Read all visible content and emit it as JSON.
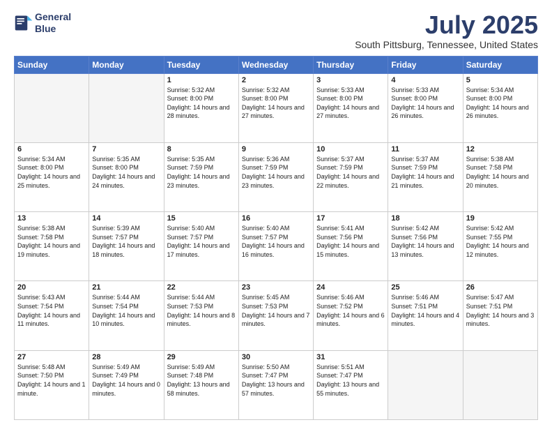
{
  "logo": {
    "line1": "General",
    "line2": "Blue"
  },
  "header": {
    "title": "July 2025",
    "subtitle": "South Pittsburg, Tennessee, United States"
  },
  "days_of_week": [
    "Sunday",
    "Monday",
    "Tuesday",
    "Wednesday",
    "Thursday",
    "Friday",
    "Saturday"
  ],
  "weeks": [
    [
      {
        "day": "",
        "content": ""
      },
      {
        "day": "",
        "content": ""
      },
      {
        "day": "1",
        "content": "Sunrise: 5:32 AM\nSunset: 8:00 PM\nDaylight: 14 hours and 28 minutes."
      },
      {
        "day": "2",
        "content": "Sunrise: 5:32 AM\nSunset: 8:00 PM\nDaylight: 14 hours and 27 minutes."
      },
      {
        "day": "3",
        "content": "Sunrise: 5:33 AM\nSunset: 8:00 PM\nDaylight: 14 hours and 27 minutes."
      },
      {
        "day": "4",
        "content": "Sunrise: 5:33 AM\nSunset: 8:00 PM\nDaylight: 14 hours and 26 minutes."
      },
      {
        "day": "5",
        "content": "Sunrise: 5:34 AM\nSunset: 8:00 PM\nDaylight: 14 hours and 26 minutes."
      }
    ],
    [
      {
        "day": "6",
        "content": "Sunrise: 5:34 AM\nSunset: 8:00 PM\nDaylight: 14 hours and 25 minutes."
      },
      {
        "day": "7",
        "content": "Sunrise: 5:35 AM\nSunset: 8:00 PM\nDaylight: 14 hours and 24 minutes."
      },
      {
        "day": "8",
        "content": "Sunrise: 5:35 AM\nSunset: 7:59 PM\nDaylight: 14 hours and 23 minutes."
      },
      {
        "day": "9",
        "content": "Sunrise: 5:36 AM\nSunset: 7:59 PM\nDaylight: 14 hours and 23 minutes."
      },
      {
        "day": "10",
        "content": "Sunrise: 5:37 AM\nSunset: 7:59 PM\nDaylight: 14 hours and 22 minutes."
      },
      {
        "day": "11",
        "content": "Sunrise: 5:37 AM\nSunset: 7:59 PM\nDaylight: 14 hours and 21 minutes."
      },
      {
        "day": "12",
        "content": "Sunrise: 5:38 AM\nSunset: 7:58 PM\nDaylight: 14 hours and 20 minutes."
      }
    ],
    [
      {
        "day": "13",
        "content": "Sunrise: 5:38 AM\nSunset: 7:58 PM\nDaylight: 14 hours and 19 minutes."
      },
      {
        "day": "14",
        "content": "Sunrise: 5:39 AM\nSunset: 7:57 PM\nDaylight: 14 hours and 18 minutes."
      },
      {
        "day": "15",
        "content": "Sunrise: 5:40 AM\nSunset: 7:57 PM\nDaylight: 14 hours and 17 minutes."
      },
      {
        "day": "16",
        "content": "Sunrise: 5:40 AM\nSunset: 7:57 PM\nDaylight: 14 hours and 16 minutes."
      },
      {
        "day": "17",
        "content": "Sunrise: 5:41 AM\nSunset: 7:56 PM\nDaylight: 14 hours and 15 minutes."
      },
      {
        "day": "18",
        "content": "Sunrise: 5:42 AM\nSunset: 7:56 PM\nDaylight: 14 hours and 13 minutes."
      },
      {
        "day": "19",
        "content": "Sunrise: 5:42 AM\nSunset: 7:55 PM\nDaylight: 14 hours and 12 minutes."
      }
    ],
    [
      {
        "day": "20",
        "content": "Sunrise: 5:43 AM\nSunset: 7:54 PM\nDaylight: 14 hours and 11 minutes."
      },
      {
        "day": "21",
        "content": "Sunrise: 5:44 AM\nSunset: 7:54 PM\nDaylight: 14 hours and 10 minutes."
      },
      {
        "day": "22",
        "content": "Sunrise: 5:44 AM\nSunset: 7:53 PM\nDaylight: 14 hours and 8 minutes."
      },
      {
        "day": "23",
        "content": "Sunrise: 5:45 AM\nSunset: 7:53 PM\nDaylight: 14 hours and 7 minutes."
      },
      {
        "day": "24",
        "content": "Sunrise: 5:46 AM\nSunset: 7:52 PM\nDaylight: 14 hours and 6 minutes."
      },
      {
        "day": "25",
        "content": "Sunrise: 5:46 AM\nSunset: 7:51 PM\nDaylight: 14 hours and 4 minutes."
      },
      {
        "day": "26",
        "content": "Sunrise: 5:47 AM\nSunset: 7:51 PM\nDaylight: 14 hours and 3 minutes."
      }
    ],
    [
      {
        "day": "27",
        "content": "Sunrise: 5:48 AM\nSunset: 7:50 PM\nDaylight: 14 hours and 1 minute."
      },
      {
        "day": "28",
        "content": "Sunrise: 5:49 AM\nSunset: 7:49 PM\nDaylight: 14 hours and 0 minutes."
      },
      {
        "day": "29",
        "content": "Sunrise: 5:49 AM\nSunset: 7:48 PM\nDaylight: 13 hours and 58 minutes."
      },
      {
        "day": "30",
        "content": "Sunrise: 5:50 AM\nSunset: 7:47 PM\nDaylight: 13 hours and 57 minutes."
      },
      {
        "day": "31",
        "content": "Sunrise: 5:51 AM\nSunset: 7:47 PM\nDaylight: 13 hours and 55 minutes."
      },
      {
        "day": "",
        "content": ""
      },
      {
        "day": "",
        "content": ""
      }
    ]
  ]
}
